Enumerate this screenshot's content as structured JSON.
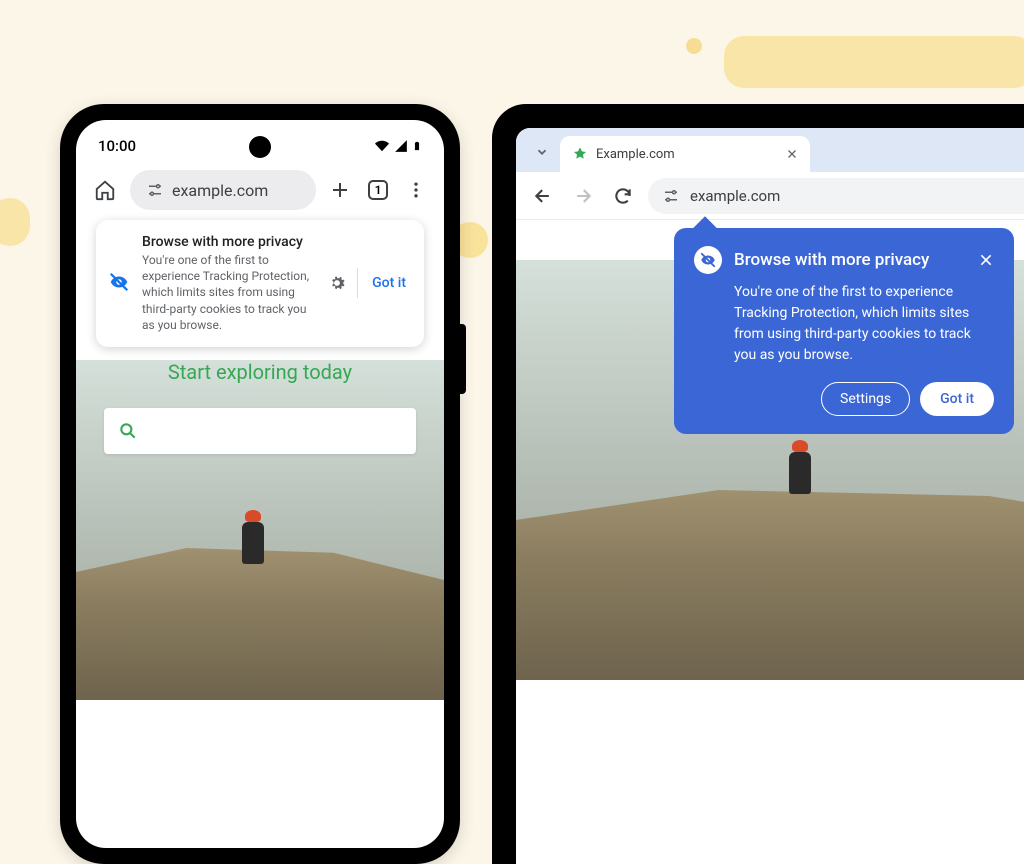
{
  "phone": {
    "status_time": "10:00",
    "url": "example.com",
    "tabs_count": "1",
    "notification": {
      "title": "Browse with more privacy",
      "body": "You're one of the first to experience Tracking Protection, which limits sites from using third-party cookies to track you as you browse.",
      "confirm": "Got it"
    },
    "hero_title": "Start exploring today"
  },
  "desktop": {
    "tab_title": "Example.com",
    "url": "example.com",
    "callout": {
      "title": "Browse with more privacy",
      "body": "You're one of the first to experience Tracking Protection, which limits sites from using third-party cookies to track you as you browse.",
      "settings": "Settings",
      "confirm": "Got it"
    }
  }
}
